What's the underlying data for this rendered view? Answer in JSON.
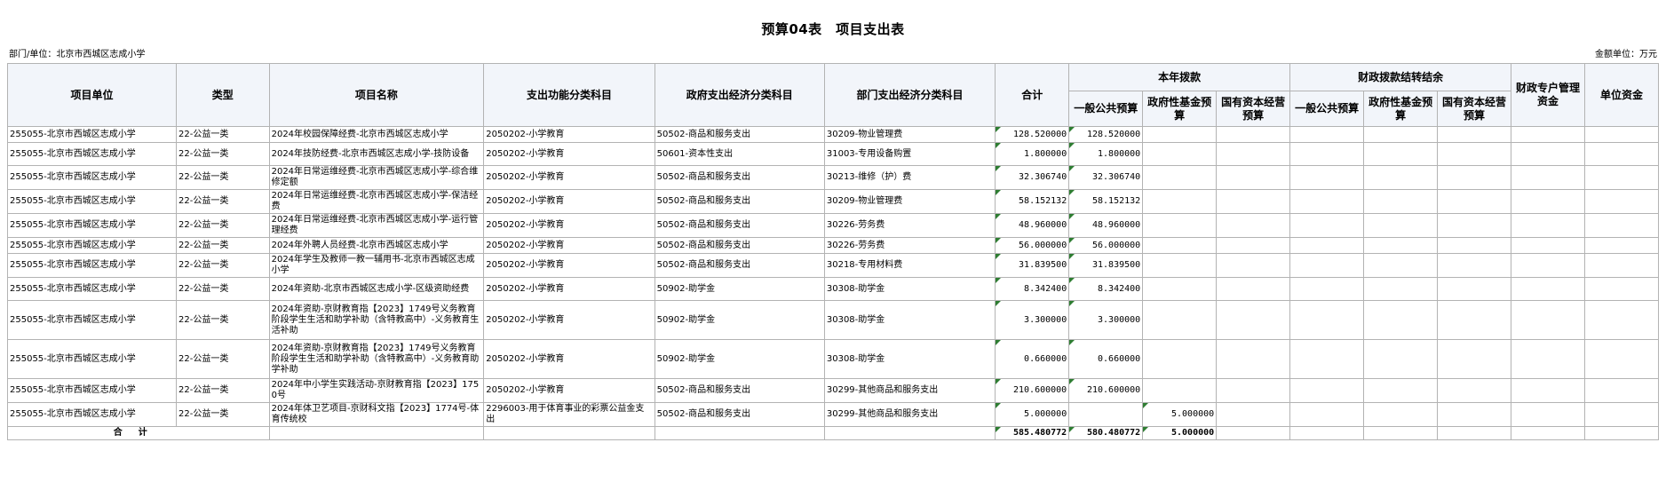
{
  "title": "预算04表　项目支出表",
  "dept_label": "部门/单位：北京市西城区志成小学",
  "unit_label": "金额单位：万元",
  "headers": {
    "unit": "项目单位",
    "type": "类型",
    "name": "项目名称",
    "func": "支出功能分类科目",
    "gov_econ": "政府支出经济分类科目",
    "dept_econ": "部门支出经济分类科目",
    "total": "合计",
    "current": "本年拨款",
    "carry": "财政拨款结转结余",
    "special": "财政专户管理资金",
    "self": "单位资金",
    "general": "一般公共预算",
    "fund": "政府性基金预算",
    "soe": "国有资本经营预算",
    "carry_general": "一般公共预算",
    "carry_fund": "政府性基金预算",
    "carry_soe": "国有资本经营预算"
  },
  "rows": [
    {
      "unit": "255055-北京市西城区志成小学",
      "type": "22-公益一类",
      "name": "2024年校园保障经费-北京市西城区志成小学",
      "func": "2050202-小学教育",
      "gov_econ": "50502-商品和服务支出",
      "dept_econ": "30209-物业管理费",
      "total": "128.520000",
      "general": "128.520000",
      "fund": ""
    },
    {
      "unit": "255055-北京市西城区志成小学",
      "type": "22-公益一类",
      "name": "2024年技防经费-北京市西城区志成小学-技防设备",
      "func": "2050202-小学教育",
      "gov_econ": "50601-资本性支出",
      "dept_econ": "31003-专用设备购置",
      "total": "1.800000",
      "general": "1.800000",
      "fund": ""
    },
    {
      "unit": "255055-北京市西城区志成小学",
      "type": "22-公益一类",
      "name": "2024年日常运维经费-北京市西城区志成小学-综合维修定额",
      "func": "2050202-小学教育",
      "gov_econ": "50502-商品和服务支出",
      "dept_econ": "30213-维修（护）费",
      "total": "32.306740",
      "general": "32.306740",
      "fund": ""
    },
    {
      "unit": "255055-北京市西城区志成小学",
      "type": "22-公益一类",
      "name": "2024年日常运维经费-北京市西城区志成小学-保洁经费",
      "func": "2050202-小学教育",
      "gov_econ": "50502-商品和服务支出",
      "dept_econ": "30209-物业管理费",
      "total": "58.152132",
      "general": "58.152132",
      "fund": ""
    },
    {
      "unit": "255055-北京市西城区志成小学",
      "type": "22-公益一类",
      "name": "2024年日常运维经费-北京市西城区志成小学-运行管理经费",
      "func": "2050202-小学教育",
      "gov_econ": "50502-商品和服务支出",
      "dept_econ": "30226-劳务费",
      "total": "48.960000",
      "general": "48.960000",
      "fund": ""
    },
    {
      "unit": "255055-北京市西城区志成小学",
      "type": "22-公益一类",
      "name": "2024年外聘人员经费-北京市西城区志成小学",
      "func": "2050202-小学教育",
      "gov_econ": "50502-商品和服务支出",
      "dept_econ": "30226-劳务费",
      "total": "56.000000",
      "general": "56.000000",
      "fund": ""
    },
    {
      "unit": "255055-北京市西城区志成小学",
      "type": "22-公益一类",
      "name": "2024年学生及教师一教一辅用书-北京市西城区志成小学",
      "func": "2050202-小学教育",
      "gov_econ": "50502-商品和服务支出",
      "dept_econ": "30218-专用材料费",
      "total": "31.839500",
      "general": "31.839500",
      "fund": ""
    },
    {
      "unit": "255055-北京市西城区志成小学",
      "type": "22-公益一类",
      "name": "2024年资助-北京市西城区志成小学-区级资助经费",
      "func": "2050202-小学教育",
      "gov_econ": "50902-助学金",
      "dept_econ": "30308-助学金",
      "total": "8.342400",
      "general": "8.342400",
      "fund": ""
    },
    {
      "unit": "255055-北京市西城区志成小学",
      "type": "22-公益一类",
      "name": "2024年资助-京财教育指【2023】1749号义务教育阶段学生生活和助学补助（含特教高中）-义务教育生活补助",
      "func": "2050202-小学教育",
      "gov_econ": "50902-助学金",
      "dept_econ": "30308-助学金",
      "total": "3.300000",
      "general": "3.300000",
      "fund": ""
    },
    {
      "unit": "255055-北京市西城区志成小学",
      "type": "22-公益一类",
      "name": "2024年资助-京财教育指【2023】1749号义务教育阶段学生生活和助学补助（含特教高中）-义务教育助学补助",
      "func": "2050202-小学教育",
      "gov_econ": "50902-助学金",
      "dept_econ": "30308-助学金",
      "total": "0.660000",
      "general": "0.660000",
      "fund": ""
    },
    {
      "unit": "255055-北京市西城区志成小学",
      "type": "22-公益一类",
      "name": "2024年中小学生实践活动-京财教育指【2023】1750号",
      "func": "2050202-小学教育",
      "gov_econ": "50502-商品和服务支出",
      "dept_econ": "30299-其他商品和服务支出",
      "total": "210.600000",
      "general": "210.600000",
      "fund": ""
    },
    {
      "unit": "255055-北京市西城区志成小学",
      "type": "22-公益一类",
      "name": "2024年体卫艺项目-京财科文指【2023】1774号-体育传统校",
      "func": "2296003-用于体育事业的彩票公益金支出",
      "gov_econ": "50502-商品和服务支出",
      "dept_econ": "30299-其他商品和服务支出",
      "total": "5.000000",
      "general": "",
      "fund": "5.000000"
    }
  ],
  "totals": {
    "label": "合计",
    "total": "585.480772",
    "general": "580.480772",
    "fund": "5.000000"
  }
}
